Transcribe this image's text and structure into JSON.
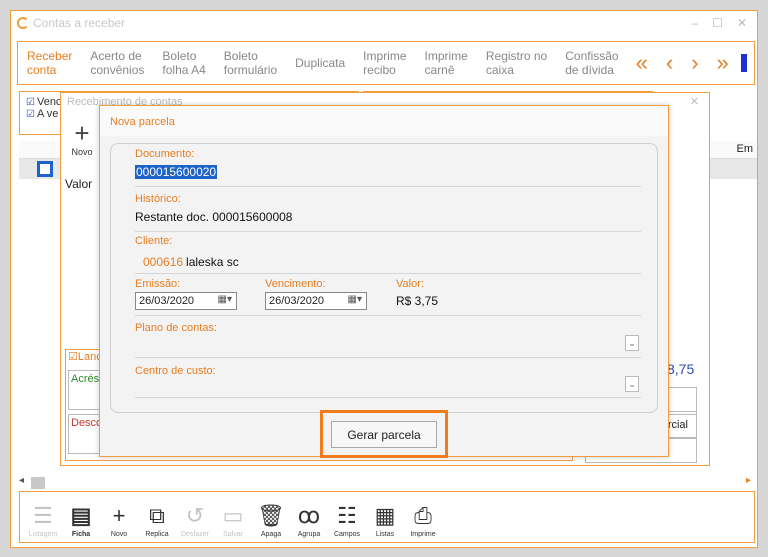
{
  "main_window": {
    "title": "Contas a receber"
  },
  "menu": [
    {
      "label": "Receber conta",
      "active": true
    },
    {
      "label": "Acerto de convênios"
    },
    {
      "label": "Boleto folha A4"
    },
    {
      "label": "Boleto formulário"
    },
    {
      "label": "Duplicata"
    },
    {
      "label": "Imprime recibo"
    },
    {
      "label": "Imprime carnê"
    },
    {
      "label": "Registro no caixa"
    },
    {
      "label": "Confissão de dívida"
    }
  ],
  "menu_labels": {
    "m0a": "Receber",
    "m0b": "conta",
    "m1a": "Acerto de",
    "m1b": "convênios",
    "m2a": "Boleto",
    "m2b": "folha A4",
    "m3a": "Boleto",
    "m3b": "formulário",
    "m4": "Duplicata",
    "m5a": "Imprime",
    "m5b": "recibo",
    "m6a": "Imprime",
    "m6b": "carnê",
    "m7a": "Registro no",
    "m7b": "caixa",
    "m8a": "Confissão",
    "m8b": "de dívida"
  },
  "filters": {
    "f1": "Venc",
    "f2": "A ve"
  },
  "grid": {
    "right_header": "Em"
  },
  "receb_dialog": {
    "title": "Recebimento de contas",
    "novo_label": "Novo",
    "valor_label": "Valor",
    "lanc_label": "Lanc",
    "acres_label": "Acrésc",
    "desco_label": "Desco",
    "total": "8,75",
    "parcial": "rcial"
  },
  "nova_parcela": {
    "title": "Nova parcela",
    "documento_label": "Documento:",
    "documento_value": "000015600020",
    "historico_label": "Histórico:",
    "historico_value": "Restante doc. 000015600008",
    "cliente_label": "Cliente:",
    "cliente_code": "000616",
    "cliente_name": "laleska sc",
    "emissao_label": "Emissão:",
    "emissao_value": "26/03/2020",
    "vencimento_label": "Vencimento:",
    "vencimento_value": "26/03/2020",
    "valor_label": "Valor:",
    "valor_value": "R$ 3,75",
    "plano_label": "Plano de contas:",
    "centro_label": "Centro de custo:",
    "gerar_label": "Gerar parcela"
  },
  "toolbar": {
    "listagem": "Listagem",
    "ficha": "Ficha",
    "novo": "Novo",
    "replica": "Replica",
    "desfazer": "Desfazer",
    "salvar": "Salvar",
    "apaga": "Apaga",
    "agrupa": "Agrupa",
    "campos": "Campos",
    "listas": "Listas",
    "imprime": "Imprime"
  },
  "colors": {
    "accent": "#f39c3c",
    "highlight": "#f07b1b",
    "selection": "#1e63c9"
  }
}
